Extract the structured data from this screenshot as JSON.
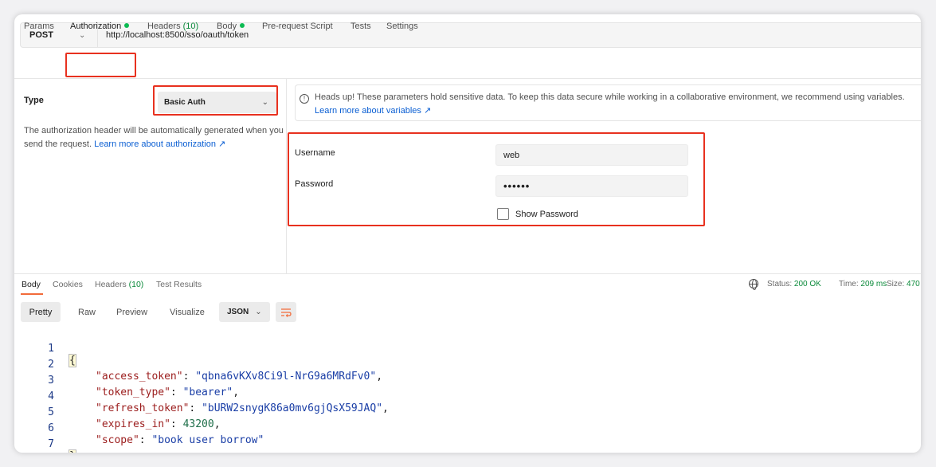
{
  "request": {
    "method": "POST",
    "url": "http://localhost:8500/sso/oauth/token",
    "tabs": {
      "params": "Params",
      "authorization": "Authorization",
      "headers": "Headers",
      "headers_count": "(10)",
      "body": "Body",
      "prerequest": "Pre-request Script",
      "tests": "Tests",
      "settings": "Settings"
    }
  },
  "auth": {
    "type_label": "Type",
    "type_value": "Basic Auth",
    "desc": "The authorization header will be automatically generated when you send the request.",
    "desc_link": "Learn more about authorization ↗",
    "banner_text": "Heads up! These parameters hold sensitive data. To keep this data secure while working in a collaborative environment, we recommend using variables.",
    "banner_link": "Learn more about variables ↗",
    "username_label": "Username",
    "username_value": "web",
    "password_label": "Password",
    "password_value": "••••••",
    "show_password": "Show Password"
  },
  "response": {
    "tabs": {
      "body": "Body",
      "cookies": "Cookies",
      "headers": "Headers",
      "headers_count": "(10)",
      "test_results": "Test Results"
    },
    "status_label": "Status:",
    "status_value": "200 OK",
    "time_label": "Time:",
    "time_value": "209 ms",
    "size_label": "Size:",
    "size_value": "470",
    "views": {
      "pretty": "Pretty",
      "raw": "Raw",
      "preview": "Preview",
      "visualize": "Visualize",
      "format": "JSON"
    },
    "code": {
      "l1_num": "1",
      "l2_num": "2",
      "l3_num": "3",
      "l4_num": "4",
      "l5_num": "5",
      "l6_num": "6",
      "l7_num": "7",
      "open": "{",
      "close": "}",
      "k_access_token": "\"access_token\"",
      "v_access_token": "\"qbna6vKXv8Ci9l-NrG9a6MRdFv0\"",
      "k_token_type": "\"token_type\"",
      "v_token_type": "\"bearer\"",
      "k_refresh_token": "\"refresh_token\"",
      "v_refresh_token": "\"bURW2snygK86a0mv6gjQsX59JAQ\"",
      "k_expires_in": "\"expires_in\"",
      "v_expires_in": "43200",
      "k_scope": "\"scope\"",
      "v_scope": "\"book user borrow\""
    }
  },
  "colors": {
    "highlight": "#e8311f",
    "active_dot": "#0cbb52",
    "tab_underline": "#f26b3a",
    "link": "#0b5fd3"
  }
}
